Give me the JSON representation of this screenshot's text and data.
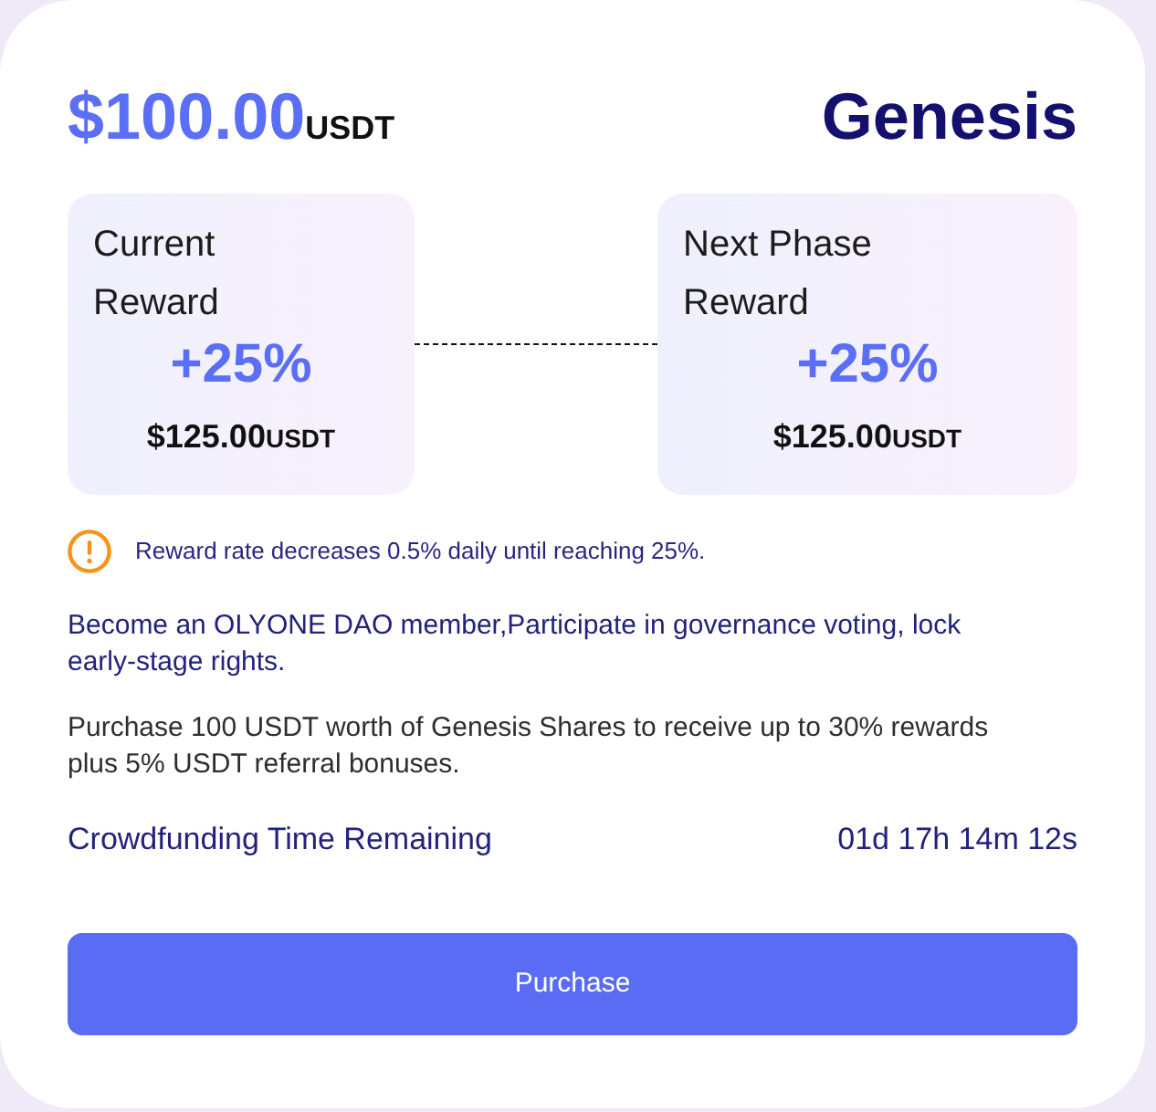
{
  "header": {
    "price": "$100.00",
    "unit": "USDT",
    "title": "Genesis"
  },
  "reward_cards": [
    {
      "label": "Current Reward",
      "percent": "+25%",
      "amount": "$125.00",
      "unit": "USDT"
    },
    {
      "label": "Next Phase Reward",
      "percent": "+25%",
      "amount": "$125.00",
      "unit": "USDT"
    }
  ],
  "notice": "Reward rate decreases 0.5% daily until reaching 25%.",
  "paragraphs": [
    {
      "kind": "highlight",
      "text": "Become an OLYONE DAO member,Participate in governance voting, lock early-stage rights."
    },
    {
      "kind": "plain",
      "text": "Purchase 100 USDT worth of Genesis Shares to receive up to 30% rewards plus 5% USDT referral bonuses."
    }
  ],
  "countdown": {
    "label": "Crowdfunding Time Remaining",
    "value": "01d 17h 14m 12s"
  },
  "button": {
    "label": "Purchase"
  }
}
